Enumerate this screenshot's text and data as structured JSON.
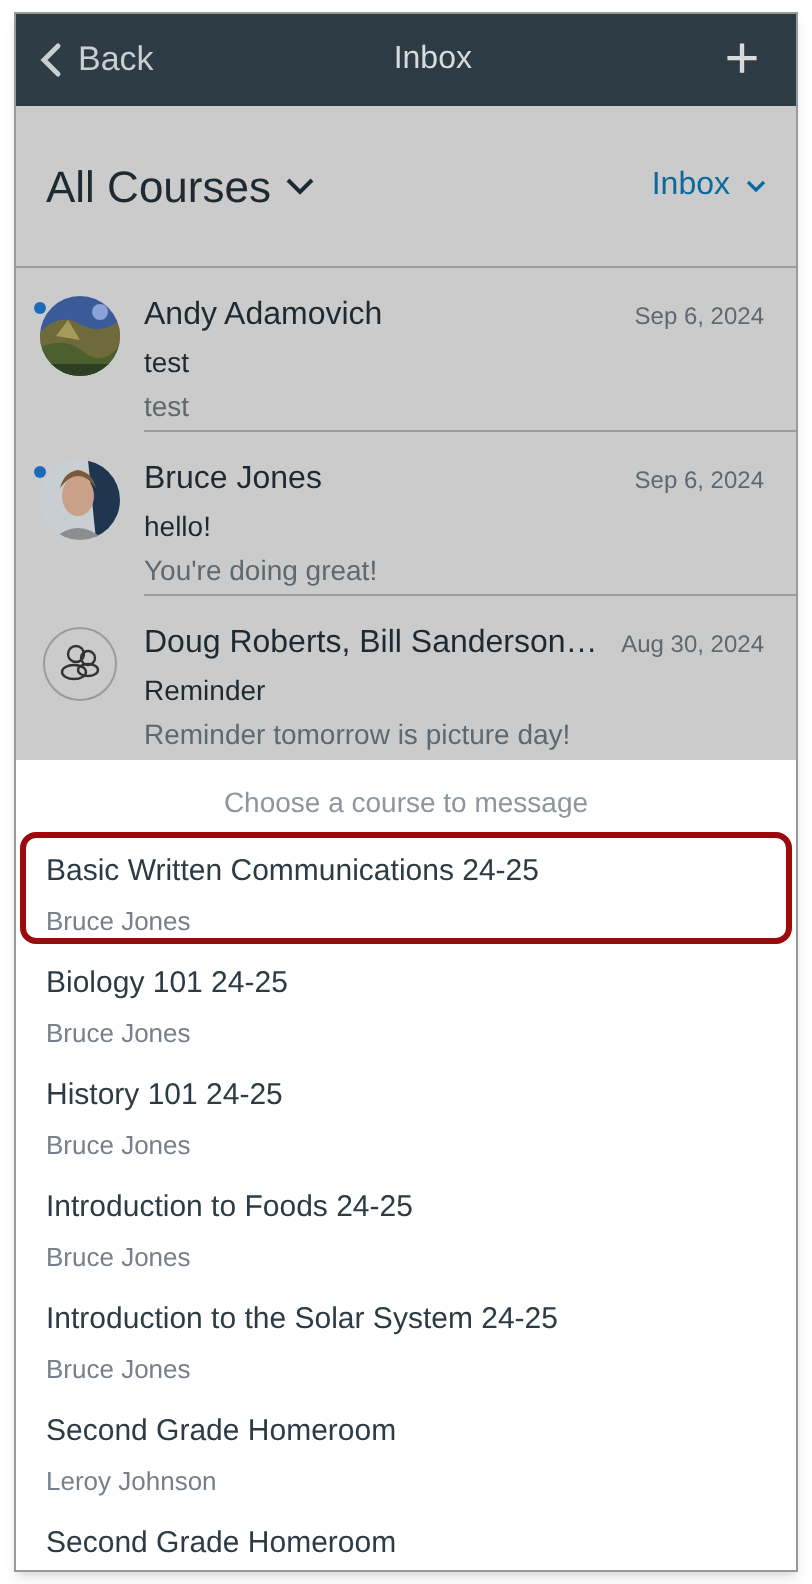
{
  "nav_bar": {
    "back": "Back",
    "title": "Inbox",
    "add": "+"
  },
  "filter": {
    "course": "All Courses",
    "mailbox": "Inbox"
  },
  "messages": [
    {
      "sender": "Andy Adamovich",
      "date": "Sep 6, 2024",
      "subject": "test",
      "preview": "test",
      "unread": true
    },
    {
      "sender": "Bruce Jones",
      "date": "Sep 6, 2024",
      "subject": "hello!",
      "preview": "You're doing great!",
      "unread": true
    },
    {
      "sender": "Doug Roberts, Bill Sanderson…",
      "date": "Aug 30, 2024",
      "subject": "Reminder",
      "preview": "Reminder tomorrow is picture day!",
      "unread": false,
      "avatar": {
        "kind": "group"
      }
    }
  ],
  "course_picker": {
    "caption": "Choose a course to message",
    "courses": [
      {
        "name": "Basic Written Communications 24-25",
        "teacher": "Bruce Jones",
        "selected": true
      },
      {
        "name": "Biology 101 24-25",
        "teacher": "Bruce Jones",
        "selected": false
      },
      {
        "name": "History 101 24-25",
        "teacher": "Bruce Jones",
        "selected": false
      },
      {
        "name": "Introduction to Foods 24-25",
        "teacher": "Bruce Jones",
        "selected": false
      },
      {
        "name": "Introduction to the Solar System  24-25",
        "teacher": "Bruce Jones",
        "selected": false
      },
      {
        "name": "Second Grade Homeroom",
        "teacher": "Leroy Johnson",
        "selected": false
      },
      {
        "name": "Second Grade Homeroom",
        "selected": false
      }
    ]
  }
}
